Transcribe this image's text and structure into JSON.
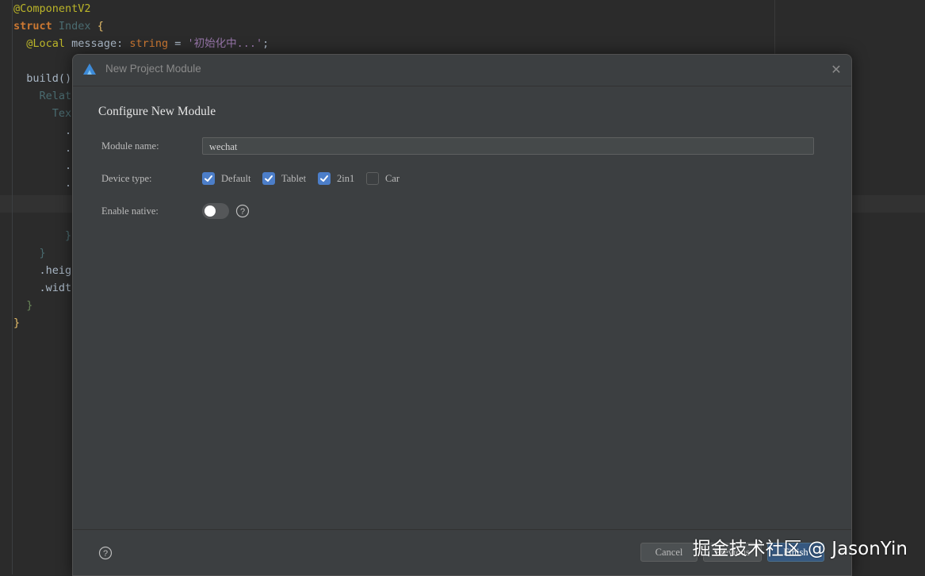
{
  "editor": {
    "lines": [
      {
        "tokens": [
          {
            "t": "@ComponentV2",
            "c": "ann"
          }
        ]
      },
      {
        "tokens": [
          {
            "t": "struct",
            "c": "kw"
          },
          {
            "t": " ",
            "c": ""
          },
          {
            "t": "Index",
            "c": "cls"
          },
          {
            "t": " {",
            "c": "brace"
          }
        ]
      },
      {
        "tokens": [
          {
            "t": "  ",
            "c": ""
          },
          {
            "t": "@Local",
            "c": "ann"
          },
          {
            "t": " message: ",
            "c": "call"
          },
          {
            "t": "string",
            "c": "type"
          },
          {
            "t": " = ",
            "c": "call"
          },
          {
            "t": "'初始化中...'",
            "c": "fld"
          },
          {
            "t": ";",
            "c": "call"
          }
        ]
      },
      {
        "tokens": []
      },
      {
        "tokens": [
          {
            "t": "  build()",
            "c": "call"
          }
        ]
      },
      {
        "tokens": [
          {
            "t": "    Relati",
            "c": "cls"
          }
        ]
      },
      {
        "tokens": [
          {
            "t": "      Text",
            "c": "cls"
          }
        ]
      },
      {
        "tokens": [
          {
            "t": "        .",
            "c": "call"
          }
        ]
      },
      {
        "tokens": [
          {
            "t": "        .",
            "c": "call"
          }
        ]
      },
      {
        "tokens": [
          {
            "t": "        .",
            "c": "call"
          }
        ]
      },
      {
        "tokens": [
          {
            "t": "        .",
            "c": "call"
          }
        ]
      },
      {
        "tokens": []
      },
      {
        "tokens": []
      },
      {
        "tokens": [
          {
            "t": "        }",
            "c": "cls"
          }
        ]
      },
      {
        "tokens": [
          {
            "t": "    }",
            "c": "cls"
          }
        ]
      },
      {
        "tokens": [
          {
            "t": "    .heig",
            "c": "call"
          }
        ]
      },
      {
        "tokens": [
          {
            "t": "    .widt",
            "c": "call"
          }
        ]
      },
      {
        "tokens": [
          {
            "t": "  }",
            "c": "str"
          }
        ]
      },
      {
        "tokens": [
          {
            "t": "}",
            "c": "brace"
          }
        ]
      }
    ]
  },
  "dialog": {
    "title": "New Project Module",
    "heading": "Configure New Module",
    "module_name_label": "Module name:",
    "module_name_value": "wechat",
    "device_type_label": "Device type:",
    "device_types": [
      {
        "label": "Default",
        "checked": true
      },
      {
        "label": "Tablet",
        "checked": true
      },
      {
        "label": "2in1",
        "checked": true
      },
      {
        "label": "Car",
        "checked": false
      }
    ],
    "enable_native_label": "Enable native:",
    "enable_native_on": false,
    "buttons": {
      "cancel": "Cancel",
      "previous": "Previous",
      "finish": "Finish"
    }
  },
  "watermark": "掘金技术社区 @ JasonYin",
  "colors": {
    "accent": "#4c7ec9",
    "dialog_bg": "#3c3f41",
    "editor_bg": "#2b2b2b"
  }
}
